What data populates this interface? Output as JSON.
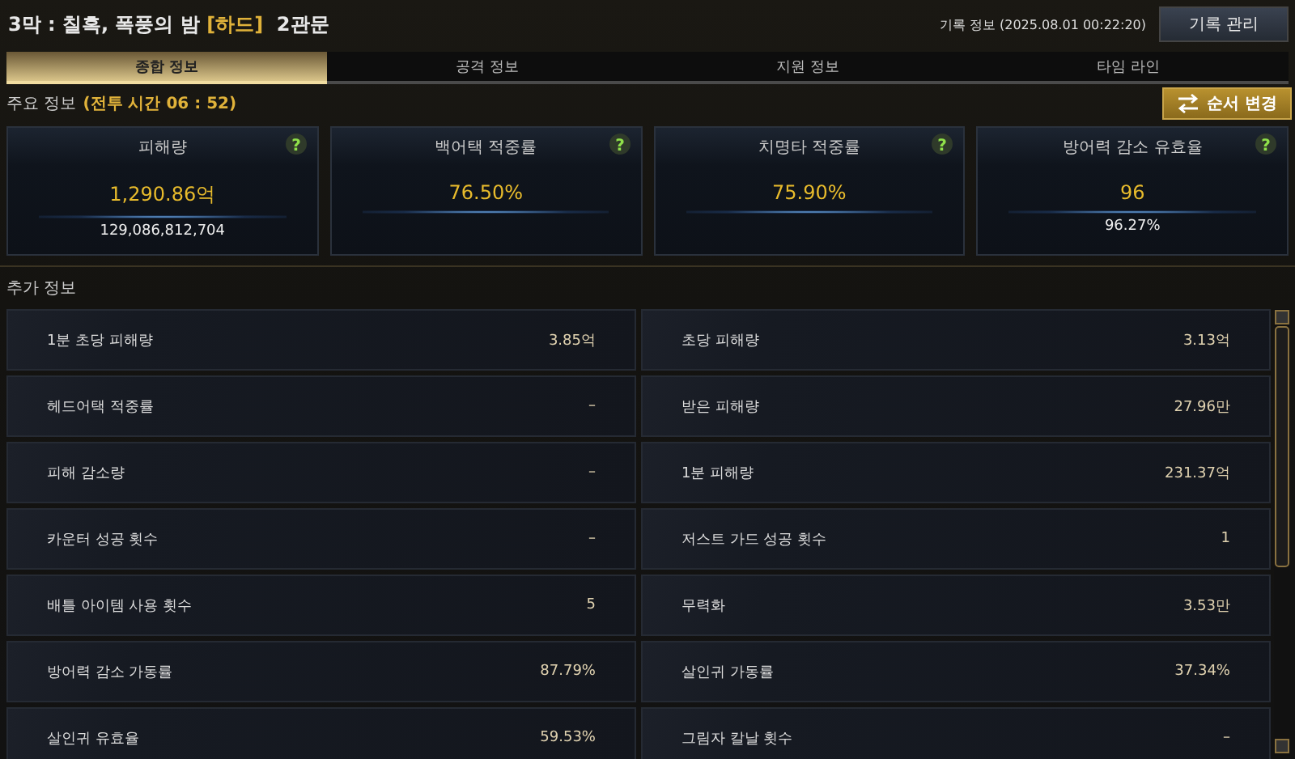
{
  "header": {
    "title": "3막 : 칠흑, 폭풍의 밤",
    "difficulty": "[하드]",
    "stage": "2관문",
    "record_info": "기록 정보 (2025.08.01 00:22:20)",
    "manage_button": "기록 관리"
  },
  "tabs": [
    {
      "label": "종합 정보",
      "selected": true
    },
    {
      "label": "공격 정보",
      "selected": false
    },
    {
      "label": "지원 정보",
      "selected": false
    },
    {
      "label": "타임 라인",
      "selected": false
    }
  ],
  "main_info": {
    "label": "주요 정보",
    "battle_time": "(전투 시간 06 : 52)",
    "order_button": "순서 변경"
  },
  "cards": [
    {
      "title": "피해량",
      "help": "?",
      "value": "1,290.86억",
      "sub": "129,086,812,704"
    },
    {
      "title": "백어택 적중률",
      "help": "?",
      "value": "76.50%"
    },
    {
      "title": "치명타 적중률",
      "help": "?",
      "value": "75.90%"
    },
    {
      "title": "방어력 감소 유효율",
      "help": "?",
      "value": "96",
      "sub": "96.27%"
    }
  ],
  "extra_info": {
    "label": "추가 정보",
    "stats": [
      {
        "label": "1분 초당 피해량",
        "value": "3.85억"
      },
      {
        "label": "초당 피해량",
        "value": "3.13억"
      },
      {
        "label": "헤드어택 적중률",
        "value": "–"
      },
      {
        "label": "받은 피해량",
        "value": "27.96만"
      },
      {
        "label": "피해 감소량",
        "value": "–"
      },
      {
        "label": "1분 피해량",
        "value": "231.37억"
      },
      {
        "label": "카운터 성공 횟수",
        "value": "–"
      },
      {
        "label": "저스트 가드 성공 횟수",
        "value": "1"
      },
      {
        "label": "배틀 아이템 사용 횟수",
        "value": "5"
      },
      {
        "label": "무력화",
        "value": "3.53만"
      },
      {
        "label": "방어력 감소 가동률",
        "value": "87.79%"
      },
      {
        "label": "살인귀 가동률",
        "value": "37.34%"
      },
      {
        "label": "살인귀 유효율",
        "value": "59.53%"
      },
      {
        "label": "그림자 칼날 횟수",
        "value": "–"
      }
    ]
  }
}
